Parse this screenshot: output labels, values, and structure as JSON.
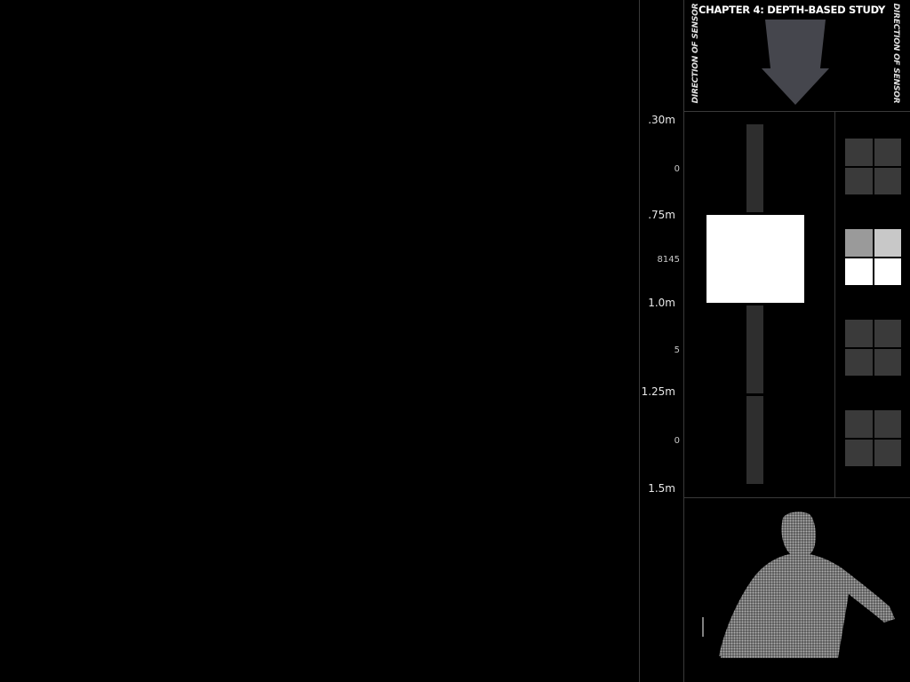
{
  "header": {
    "title": "CHAPTER 4: DEPTH-BASED STUDY",
    "left_label": "DIRECTION OF SENSOR",
    "right_label": "DIRECTION OF SENSOR",
    "arrow_icon": "down-arrow-icon"
  },
  "scale": {
    "marks": [
      ".30m",
      ".75m",
      "1.0m",
      "1.25m",
      "1.5m"
    ],
    "minor": [
      "0",
      "8145",
      "5",
      "0"
    ]
  },
  "depth_column": {
    "active_zone": 2,
    "zone_count": 5
  },
  "grids": [
    {
      "cells": [
        "#3a3a3a",
        "#3a3a3a",
        "#3a3a3a",
        "#3a3a3a"
      ]
    },
    {
      "cells": [
        "#9a9a9a",
        "#c8c8c8",
        "#ffffff",
        "#ffffff"
      ]
    },
    {
      "cells": [
        "#3a3a3a",
        "#3a3a3a",
        "#3a3a3a",
        "#3a3a3a"
      ]
    },
    {
      "cells": [
        "#3a3a3a",
        "#3a3a3a",
        "#3a3a3a",
        "#3a3a3a"
      ]
    }
  ],
  "colors": {
    "background": "#000000",
    "divider": "#3a3a3a",
    "inactive": "#2e2e2e",
    "active": "#ffffff",
    "arrow": "#45464d",
    "cloud": "#9a9a9a"
  }
}
